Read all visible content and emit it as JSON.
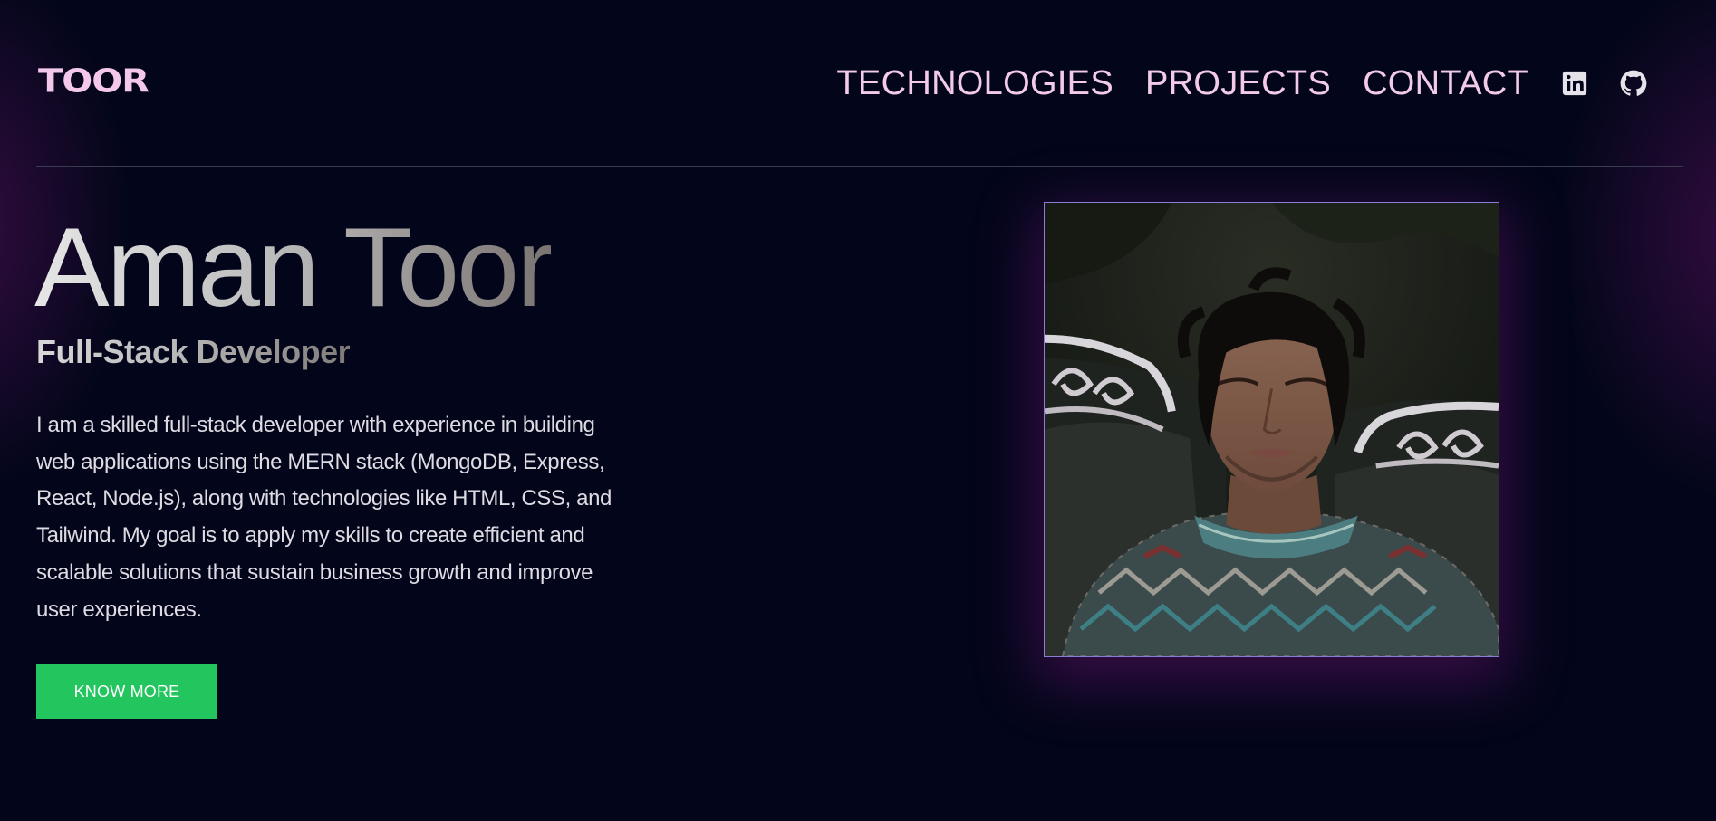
{
  "header": {
    "logo_text": "TOOR",
    "nav": [
      {
        "label": "TECHNOLOGIES"
      },
      {
        "label": "PROJECTS"
      },
      {
        "label": "CONTACT"
      }
    ],
    "social_icons": [
      "linkedin-icon",
      "github-icon"
    ]
  },
  "hero": {
    "name": "Aman Toor",
    "role": "Full-Stack Developer",
    "bio": "I am a skilled full-stack developer with experience in building web applications using the MERN stack (MongoDB, Express, React, Node.js), along with technologies like HTML, CSS, and Tailwind. My goal is to apply my skills to create efficient and scalable solutions that sustain business growth and improve user experiences.",
    "cta_label": "KNOW MORE"
  },
  "colors": {
    "background": "#03061a",
    "nav_text": "#f3cbe9",
    "accent_button": "#22c55e",
    "photo_border": "#8a7fd6",
    "glow": "#7a1a7a"
  }
}
